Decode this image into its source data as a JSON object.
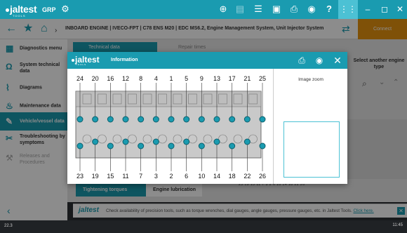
{
  "app": {
    "logo_text": "jaltest",
    "logo_sub": "TOOLS",
    "section": "GRP",
    "accent": "#1a9bb0",
    "connect_color": "#e8940f"
  },
  "topbar_icons": [
    "steering-wheel-icon",
    "document-icon",
    "list-icon",
    "briefcase-icon",
    "print-icon",
    "camera-icon",
    "help-icon",
    "grid-icon"
  ],
  "window": {
    "minimize": "–",
    "maximize": "◻",
    "close": "✕"
  },
  "navbar": {
    "breadcrumb": "INBOARD ENGINE  |  IVECO-FPT  |  C78 ENS M20  |  EDC MS6.2, Engine Management System, Unit Injector System",
    "connect_label": "Connect"
  },
  "sidebar": {
    "items": [
      {
        "label": "Diagnostics menu",
        "icon": "grid-icon",
        "state": "normal"
      },
      {
        "label": "System technical data",
        "icon": "omega-icon",
        "state": "normal"
      },
      {
        "label": "Diagrams",
        "icon": "diagram-icon",
        "state": "normal"
      },
      {
        "label": "Maintenance data",
        "icon": "oil-can-icon",
        "state": "normal"
      },
      {
        "label": "Vehicle/vessel data",
        "icon": "wrench-icon",
        "state": "active"
      },
      {
        "label": "Troubleshooting by symptoms",
        "icon": "tools-icon",
        "state": "normal"
      },
      {
        "label": "Releases and Procedures",
        "icon": "procedure-icon",
        "state": "disabled"
      }
    ]
  },
  "background": {
    "tabs": [
      "Technical data",
      "Repair times"
    ],
    "right_panel": "Select another engine type",
    "table_row": "23  19  15  11   7   3   2   6  10  14  18  22  26",
    "bottom_tabs": [
      "Tightening torques",
      "Engine lubrication"
    ]
  },
  "footer": {
    "logo": "jaltest",
    "text": "Check availability of precision tools, such as torque wrenches, dial gauges, angle gauges, pressure gauges, etc. in Jaltest Tools. ",
    "link": "Click here."
  },
  "statusbar": {
    "left": "22.3",
    "right": "11:45"
  },
  "modal": {
    "title": "Information",
    "logo": "jaltest",
    "logo_sub": "TOOLS",
    "image_zoom_label": "Image zoom",
    "top_numbers": [
      "24",
      "20",
      "16",
      "12",
      "8",
      "4",
      "1",
      "5",
      "9",
      "13",
      "17",
      "21",
      "25"
    ],
    "bottom_numbers": [
      "23",
      "19",
      "15",
      "11",
      "7",
      "3",
      "2",
      "6",
      "10",
      "14",
      "18",
      "22",
      "26"
    ]
  }
}
